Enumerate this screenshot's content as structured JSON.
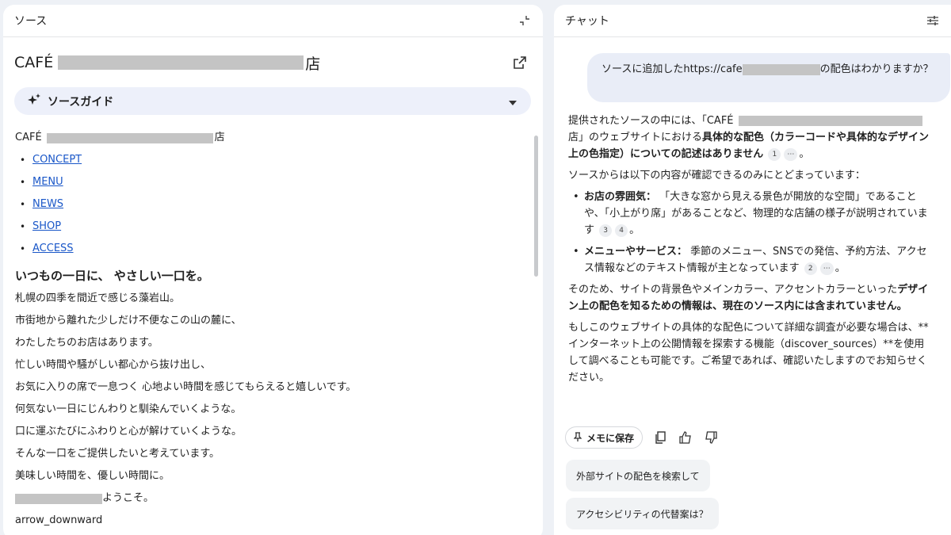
{
  "source_panel": {
    "title": "ソース",
    "doc_title_prefix": "CAFÉ",
    "doc_title_suffix": "店",
    "guide_label": "ソースガイド",
    "name_prefix": "CAFÉ",
    "name_suffix": "店",
    "nav_links": [
      "CONCEPT",
      "MENU",
      "NEWS",
      "SHOP",
      "ACCESS"
    ],
    "heading": "いつもの一日に、 やさしい一口を。",
    "lines": [
      "札幌の四季を間近で感じる藻岩山。",
      "市街地から離れた少しだけ不便なこの山の麓に、",
      "わたしたちのお店はあります。",
      "忙しい時間や騒がしい都心から抜け出し、",
      "お気に入りの席で一息つく 心地よい時間を感じてもらえると嬉しいです。",
      "何気ない一日にじんわりと馴染んでいくような。",
      "口に運ぶたびにふわりと心が解けていくような。",
      "そんな一口をご提供したいと考えています。",
      "美味しい時間を、優しい時間に。"
    ],
    "welcome_suffix": "ようこそ。",
    "arrow_text": "arrow_downward"
  },
  "chat_panel": {
    "title": "チャット",
    "user_message_prefix": "ソースに追加したhttps://cafe",
    "user_message_suffix": "の配色はわかりますか？",
    "answer": {
      "p1_a": "提供されたソースの中には、「CAFÉ",
      "p1_b": "店」のウェブサイトにおける",
      "p1_bold": "具体的な配色（カラーコードや具体的なデザイン上の色指定）についての記述はありません",
      "p1_end": "。",
      "cite_1": "1",
      "cite_more": "⋯",
      "p2": "ソースからは以下の内容が確認できるのみにとどまっています：",
      "b1_label": "お店の雰囲気：",
      "b1_text": "「大きな窓から見える景色が開放的な空間」であることや、「小上がり席」があることなど、物理的な店舗の様子が説明されています",
      "cite_3": "3",
      "cite_4": "4",
      "b1_end": "。",
      "b2_label": "メニューやサービス：",
      "b2_text": "季節のメニュー、SNSでの発信、予約方法、アクセス情報などのテキスト情報が主となっています",
      "cite_2": "2",
      "b2_end": "。",
      "p3_a": "そのため、サイトの背景色やメインカラー、アクセントカラーといった",
      "p3_bold": "デザイン上の配色を知るための情報は、現在のソース内には含まれていません。",
      "p4": "もしこのウェブサイトの具体的な配色について詳細な調査が必要な場合は、**インターネット上の公開情報を探索する機能（discover_sources）**を使用して調べることも可能です。ご希望であれば、確認いたしますのでお知らせください。"
    },
    "memo_label": "メモに保存",
    "suggestions": [
      "外部サイトの配色を検索して",
      "アクセシビリティの代替案は？"
    ]
  },
  "colors": {
    "link": "#1a57c8",
    "redaction": "#c4c4c4",
    "guide_bg": "#edf0fa",
    "user_bubble": "#e9edf7"
  }
}
